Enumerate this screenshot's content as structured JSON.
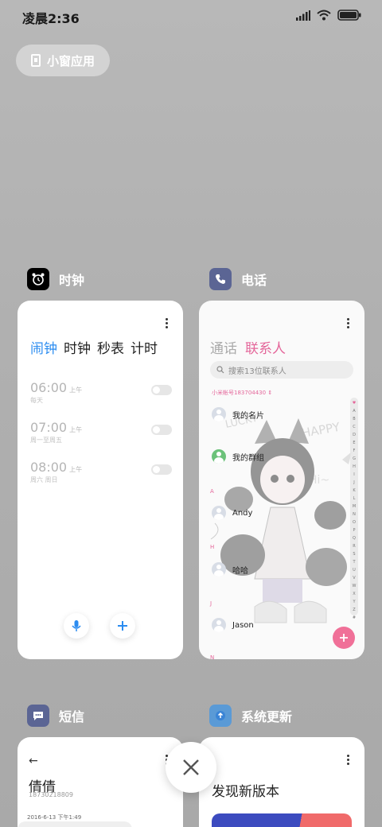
{
  "status_bar": {
    "time": "凌晨2:36"
  },
  "floating_window_button": {
    "label": "小窗应用"
  },
  "cards": {
    "clock": {
      "app_name": "时钟",
      "tabs": [
        "闹钟",
        "时钟",
        "秒表",
        "计时"
      ],
      "alarms": [
        {
          "time": "06:00",
          "ampm": "上午",
          "days": "每天",
          "enabled": false
        },
        {
          "time": "07:00",
          "ampm": "上午",
          "days": "周一至周五",
          "enabled": false
        },
        {
          "time": "08:00",
          "ampm": "上午",
          "days": "周六 周日",
          "enabled": false
        }
      ]
    },
    "phone": {
      "app_name": "电话",
      "tabs": [
        "通话",
        "联系人"
      ],
      "search_placeholder": "搜索13位联系人",
      "mi_account": "小米帐号183704430",
      "contacts": [
        "我的名片",
        "我的群组",
        "Andy",
        "哈哈",
        "Jason"
      ],
      "section_letters": [
        "A",
        "H",
        "J",
        "N"
      ],
      "alpha_index": [
        "♥",
        "A",
        "B",
        "C",
        "D",
        "E",
        "F",
        "G",
        "H",
        "I",
        "J",
        "K",
        "L",
        "M",
        "N",
        "O",
        "P",
        "Q",
        "R",
        "S",
        "T",
        "U",
        "V",
        "W",
        "X",
        "Y",
        "Z",
        "#"
      ],
      "art_text": {
        "lucky": "LUCKY",
        "happy": "HAPPY",
        "hi": "Hi~"
      }
    },
    "sms": {
      "app_name": "短信",
      "contact_name": "倩倩",
      "contact_number": "18730218809",
      "date": "2016-6-13 下午1:49"
    },
    "update": {
      "app_name": "系统更新",
      "title": "发现新版本"
    }
  },
  "colors": {
    "accent_blue": "#2b8cf0",
    "accent_pink": "#e4669a"
  }
}
